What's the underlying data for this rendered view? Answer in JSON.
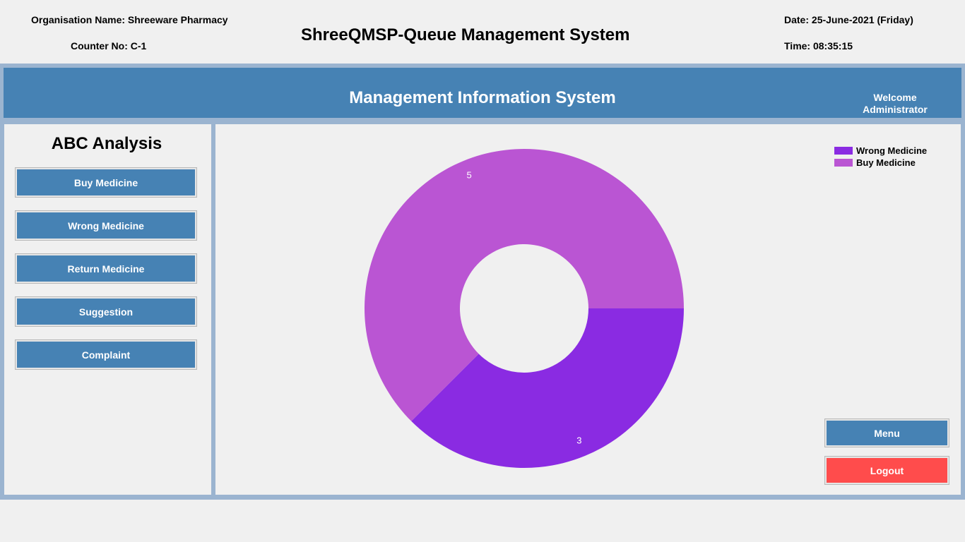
{
  "header": {
    "org_label": "Organisation Name:",
    "org_value": "Shreeware Pharmacy",
    "counter_label": "Counter No:",
    "counter_value": "C-1",
    "app_title": "ShreeQMSP-Queue Management System",
    "date_label": "Date:",
    "date_value": "25-June-2021 (Friday)",
    "time_label": "Time:",
    "time_value": "08:35:15"
  },
  "mis_bar": {
    "title": "Management Information System",
    "welcome_line1": "Welcome",
    "welcome_line2": "Administrator"
  },
  "left_panel": {
    "heading": "ABC Analysis",
    "buttons": [
      {
        "label": "Buy Medicine"
      },
      {
        "label": "Wrong Medicine"
      },
      {
        "label": "Return Medicine"
      },
      {
        "label": "Suggestion"
      },
      {
        "label": "Complaint"
      }
    ]
  },
  "right_panel": {
    "menu_label": "Menu",
    "logout_label": "Logout"
  },
  "colors": {
    "accent": "#4682b4",
    "logout": "#ff4c4c",
    "wrong_medicine": "#8a2be2",
    "buy_medicine": "#ba55d3"
  },
  "chart_data": {
    "type": "pie",
    "donut": true,
    "legend_position": "top-right",
    "series": [
      {
        "name": "Wrong Medicine",
        "value": 3,
        "color": "#8a2be2"
      },
      {
        "name": "Buy Medicine",
        "value": 5,
        "color": "#ba55d3"
      }
    ]
  }
}
